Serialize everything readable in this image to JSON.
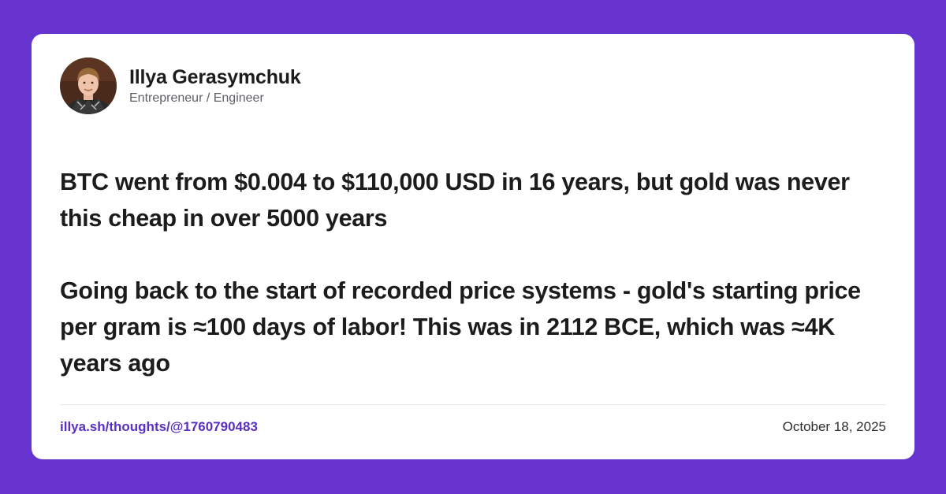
{
  "colors": {
    "background": "#6733CF",
    "card": "#ffffff",
    "text": "#1c1c1e",
    "link": "#5A2FC2"
  },
  "author": {
    "name": "Illya Gerasymchuk",
    "role": "Entrepreneur / Engineer",
    "avatar_icon": "profile-photo"
  },
  "post": {
    "paragraphs": [
      "BTC went from $0.004 to $110,000 USD in 16 years, but gold was never this cheap in over 5000 years",
      "Going back to the start of recorded price systems - gold's starting price per gram is ≈100 days of labor! This was in 2112 BCE, which was ≈4K years ago"
    ]
  },
  "footer": {
    "link": "illya.sh/thoughts/@1760790483",
    "date": "October 18, 2025"
  }
}
